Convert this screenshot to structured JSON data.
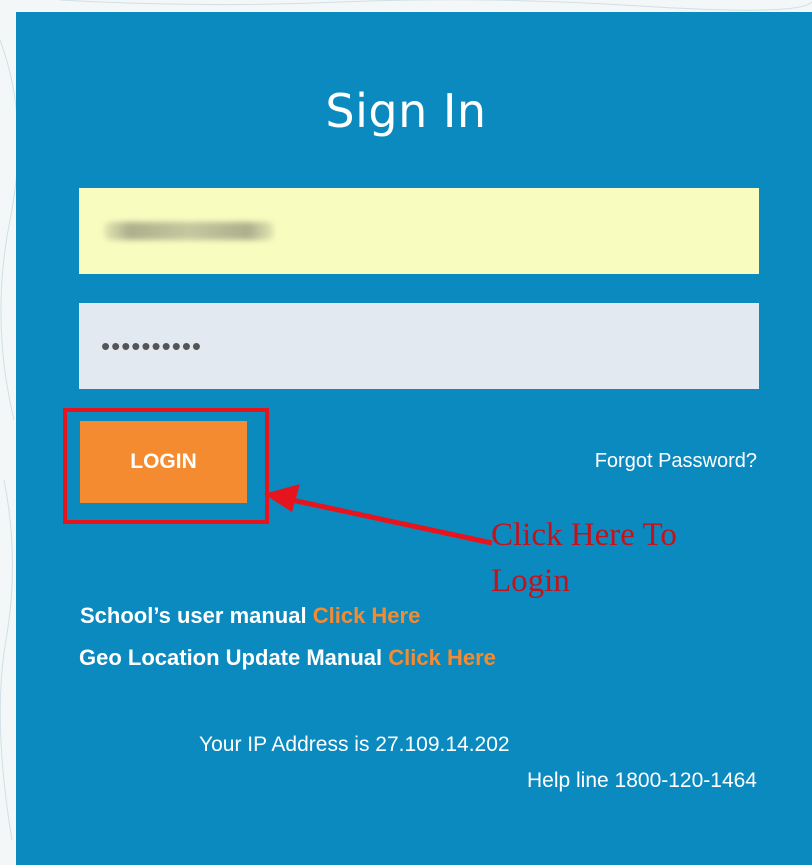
{
  "form": {
    "title": "Sign In",
    "username_value": "",
    "password_value": "••••••••••",
    "login_label": "LOGIN",
    "forgot_label": "Forgot Password?"
  },
  "annotation": {
    "line1": "Click Here To",
    "line2": "Login"
  },
  "manuals": {
    "school_text": "School’s user manual",
    "school_link": "Click Here",
    "geo_text": "Geo Location Update Manual",
    "geo_link": "Click Here"
  },
  "footer": {
    "ip_text": "Your IP Address is 27.109.14.202",
    "helpline_text": "Help line 1800-120-1464"
  },
  "colors": {
    "panel": "#0b8ac0",
    "button": "#f58b31",
    "link": "#f58b31",
    "highlight": "#e6141c",
    "username_bg": "#f8fdbf",
    "password_bg": "#e3e9f1"
  }
}
